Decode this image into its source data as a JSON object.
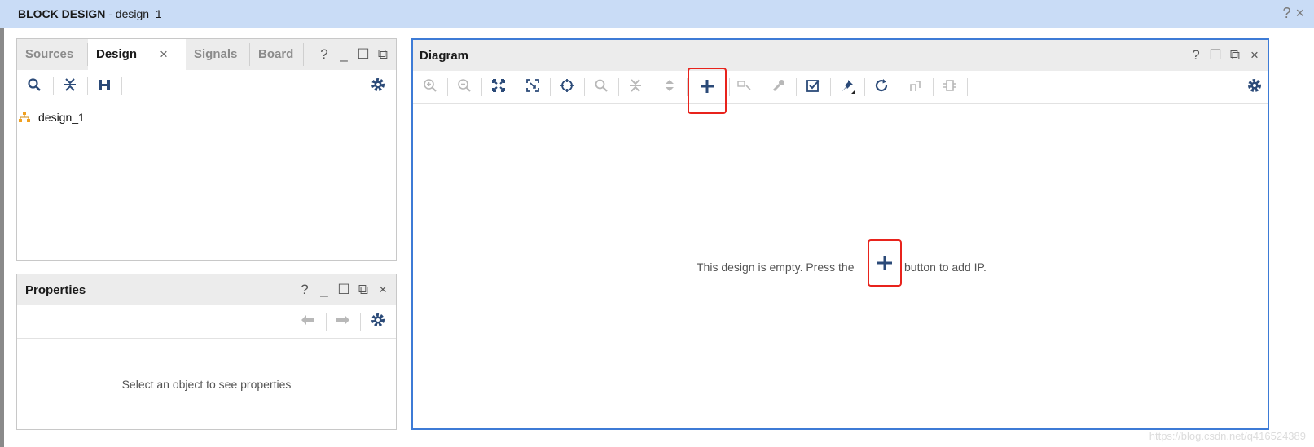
{
  "window": {
    "title_bold": "BLOCK DESIGN",
    "title_rest": " - design_1",
    "help": "?",
    "close": "×"
  },
  "sources_panel": {
    "tabs": [
      {
        "label": "Sources",
        "active": false
      },
      {
        "label": "Design",
        "active": true
      },
      {
        "label": "Signals",
        "active": false
      },
      {
        "label": "Board",
        "active": false
      }
    ],
    "tab_close": "×",
    "controls": [
      "?",
      "_",
      "☐",
      "⧉"
    ],
    "toolbar": [
      "search-icon",
      "collapse-all-icon",
      "expand-all-icon",
      "gear-icon"
    ],
    "tree": [
      {
        "label": "design_1",
        "icon": "hierarchy-icon"
      }
    ]
  },
  "properties_panel": {
    "title": "Properties",
    "controls": [
      "?",
      "_",
      "☐",
      "⧉",
      "×"
    ],
    "nav": [
      "back-arrow-icon",
      "forward-arrow-icon",
      "gear-icon"
    ],
    "empty_text": "Select an object to see properties"
  },
  "diagram_panel": {
    "title": "Diagram",
    "controls": [
      "?",
      "☐",
      "⧉",
      "×"
    ],
    "toolbar": [
      "zoom-in-icon",
      "zoom-out-icon",
      "zoom-fit-icon",
      "zoom-area-icon",
      "center-icon",
      "search-icon",
      "collapse-icon",
      "expand-icon",
      "add-ip-icon",
      "add-port-icon",
      "wrench-icon",
      "validate-icon",
      "pin-icon",
      "refresh-icon",
      "regenerate-icon",
      "module-icon",
      "gear-icon"
    ],
    "message_before": "This design is empty. Press the",
    "message_after": "button to add IP.",
    "add_glyph": "+"
  },
  "watermark": "https://blog.csdn.net/q416524389",
  "colors": {
    "accent": "#3d7bd6",
    "highlight": "#e8231c",
    "icon": "#2b4a78",
    "titlebar": "#c9dcf6"
  }
}
